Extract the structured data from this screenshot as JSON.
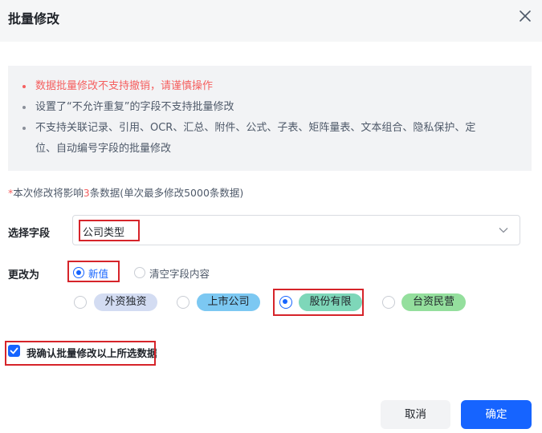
{
  "dialog": {
    "title": "批量修改"
  },
  "notice": {
    "items": [
      "数据批量修改不支持撤销，请谨慎操作",
      "设置了“不允许重复”的字段不支持批量修改",
      "不支持关联记录、引用、OCR、汇总、附件、公式、子表、矩阵量表、文本组合、隐私保护、定",
      "位、自动编号字段的批量修改"
    ]
  },
  "impact": {
    "prefix": "*",
    "before": "本次修改将影响",
    "count": "3",
    "after": "条数据(单次最多修改5000条数据)"
  },
  "field": {
    "label": "选择字段",
    "value": "公司类型"
  },
  "change": {
    "label": "更改为",
    "options": [
      {
        "label": "新值",
        "selected": true
      },
      {
        "label": "清空字段内容",
        "selected": false
      }
    ]
  },
  "values": [
    {
      "label": "外资独资",
      "color": "#d3dcf2",
      "selected": false
    },
    {
      "label": "上市公司",
      "color": "#7cc8f2",
      "selected": false
    },
    {
      "label": "股份有限",
      "color": "#7ed7b9",
      "selected": true
    },
    {
      "label": "台资民营",
      "color": "#94df9d",
      "selected": false
    }
  ],
  "confirm": {
    "label": "我确认批量修改以上所选数据",
    "checked": true
  },
  "buttons": {
    "cancel": "取消",
    "ok": "确定"
  },
  "colors": {
    "primary": "#1664ff",
    "warning": "#f55f5f",
    "highlight": "#d6242a"
  }
}
